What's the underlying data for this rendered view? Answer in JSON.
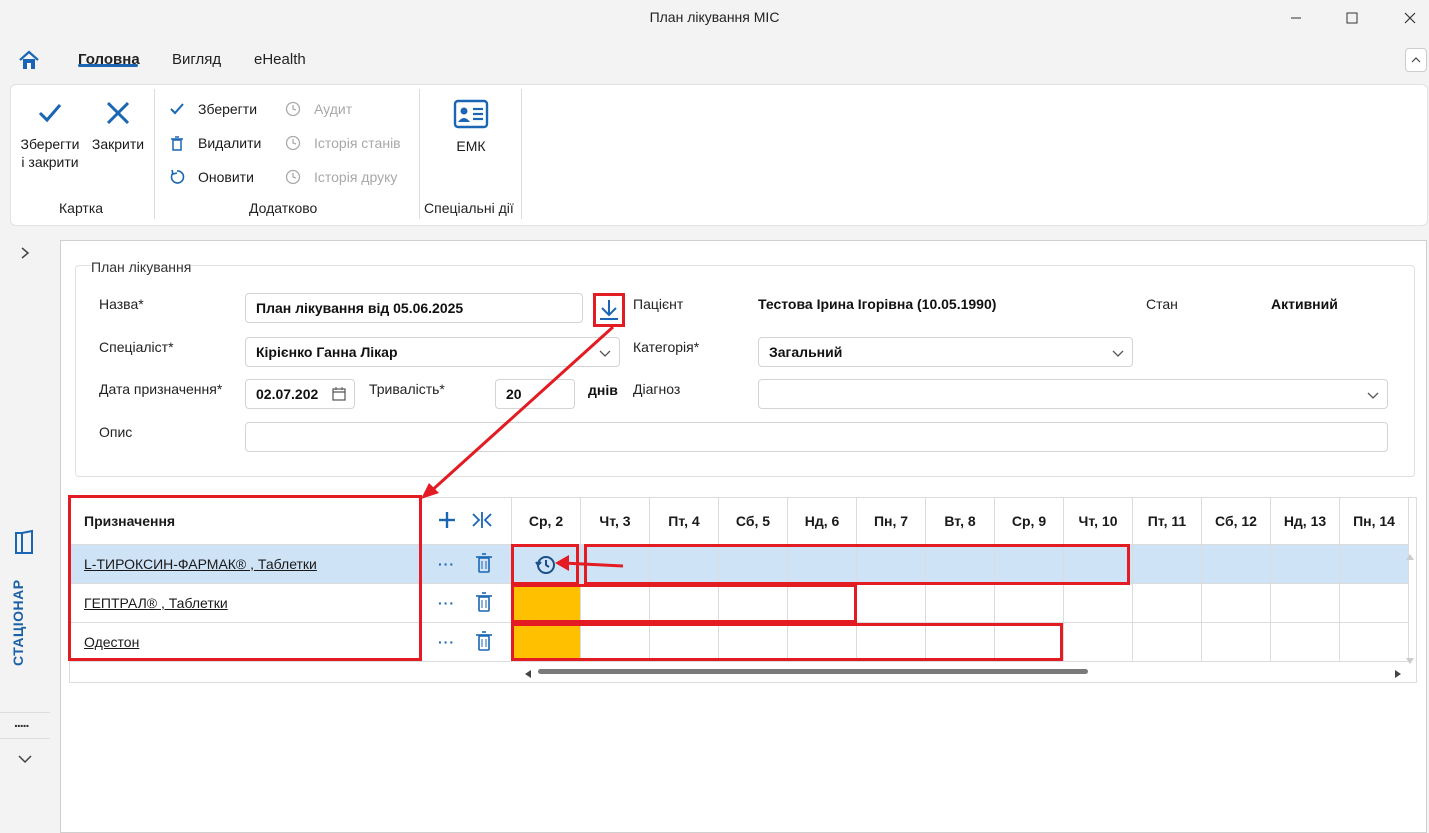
{
  "window": {
    "title": "План лікування МІС"
  },
  "ribbon": {
    "tabs": [
      {
        "label": "Головна",
        "active": true
      },
      {
        "label": "Вигляд",
        "active": false
      },
      {
        "label": "eHealth",
        "active": false
      }
    ],
    "groups": {
      "card": {
        "label": "Картка",
        "save_close": "Зберегти\nі закрити",
        "save_close_l1": "Зберегти",
        "save_close_l2": "і закрити",
        "close": "Закрити"
      },
      "extra": {
        "label": "Додатково",
        "save": "Зберегти",
        "delete": "Видалити",
        "refresh": "Оновити",
        "audit": "Аудит",
        "state_history": "Історія станів",
        "print_history": "Історія друку"
      },
      "special": {
        "label": "Спеціальні дії",
        "emk": "ЕМК"
      }
    }
  },
  "rail": {
    "label": "СТАЦІОНАР"
  },
  "form": {
    "legend": "План лікування",
    "name_label": "Назва*",
    "name_value": "План лікування від 05.06.2025",
    "patient_label": "Пацієнт",
    "patient_value": "Тестова Ірина Ігорівна (10.05.1990)",
    "state_label": "Стан",
    "state_value": "Активний",
    "specialist_label": "Спеціаліст*",
    "specialist_value": "Кірієнко Ганна Лікар",
    "category_label": "Категорія*",
    "category_value": "Загальний",
    "date_label": "Дата призначення*",
    "date_value": "02.07.202",
    "duration_label": "Тривалість*",
    "duration_value": "20",
    "duration_unit": "днів",
    "diagnosis_label": "Діагноз",
    "diagnosis_value": "",
    "description_label": "Опис",
    "description_value": ""
  },
  "grid": {
    "header_label": "Призначення",
    "days": [
      "Ср, 2",
      "Чт, 3",
      "Пт, 4",
      "Сб, 5",
      "Нд, 6",
      "Пн, 7",
      "Вт, 8",
      "Ср, 9",
      "Чт, 10",
      "Пт, 11",
      "Сб, 12",
      "Нд, 13",
      "Пн, 14"
    ],
    "rows": [
      {
        "name": "L-ТИРОКСИН-ФАРМАК® , Таблетки",
        "selected": true
      },
      {
        "name": "ГЕПТРАЛ® , Таблетки",
        "selected": false
      },
      {
        "name": "Одестон",
        "selected": false
      }
    ]
  },
  "colors": {
    "accent": "#1a66b5",
    "selected_row": "#cfe3f7",
    "marked_cell": "#ffc000",
    "annotation": "#e31b23"
  }
}
